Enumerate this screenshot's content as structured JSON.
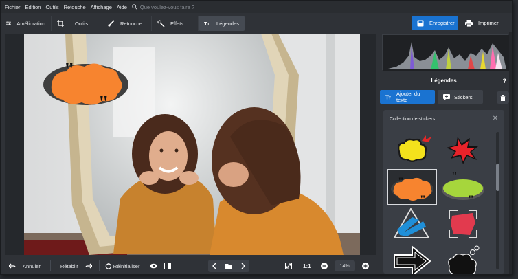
{
  "menu": {
    "items": [
      "Fichier",
      "Edition",
      "Outils",
      "Retouche",
      "Affichage",
      "Aide"
    ],
    "search_placeholder": "Que voulez-vous faire ?"
  },
  "toolbar": {
    "tabs": [
      {
        "label": "Amélioration",
        "icon": "sliders-icon"
      },
      {
        "label": "Outils",
        "icon": "crop-icon"
      },
      {
        "label": "Retouche",
        "icon": "brush-icon"
      },
      {
        "label": "Effets",
        "icon": "magic-wand-icon"
      },
      {
        "label": "Légendes",
        "icon": "text-icon"
      }
    ],
    "active_tab": "Légendes",
    "save_label": "Enregistrer",
    "print_label": "Imprimer"
  },
  "bottombar": {
    "undo_label": "Annuler",
    "redo_label": "Rétablir",
    "reset_label": "Réinitialiser",
    "fit_label": "1:1",
    "zoom_value": "14%"
  },
  "panel": {
    "title": "Légendes",
    "help_label": "?",
    "tab_add_text": "Ajouter du texte",
    "tab_stickers": "Stickers",
    "sticker_collection_title": "Collection de stickers",
    "close_label": "✕",
    "stickers": [
      {
        "name": "yellow-speech-burst"
      },
      {
        "name": "red-explosion"
      },
      {
        "name": "orange-cloud-bubble",
        "selected": true
      },
      {
        "name": "green-oval-bubble"
      },
      {
        "name": "blue-scribble-triangle"
      },
      {
        "name": "red-scribble-square"
      },
      {
        "name": "arrow-right"
      },
      {
        "name": "black-thought-cloud"
      }
    ]
  },
  "colors": {
    "accent": "#1a73d1",
    "sticker_orange": "#f7842f",
    "background": "#2f3237"
  }
}
